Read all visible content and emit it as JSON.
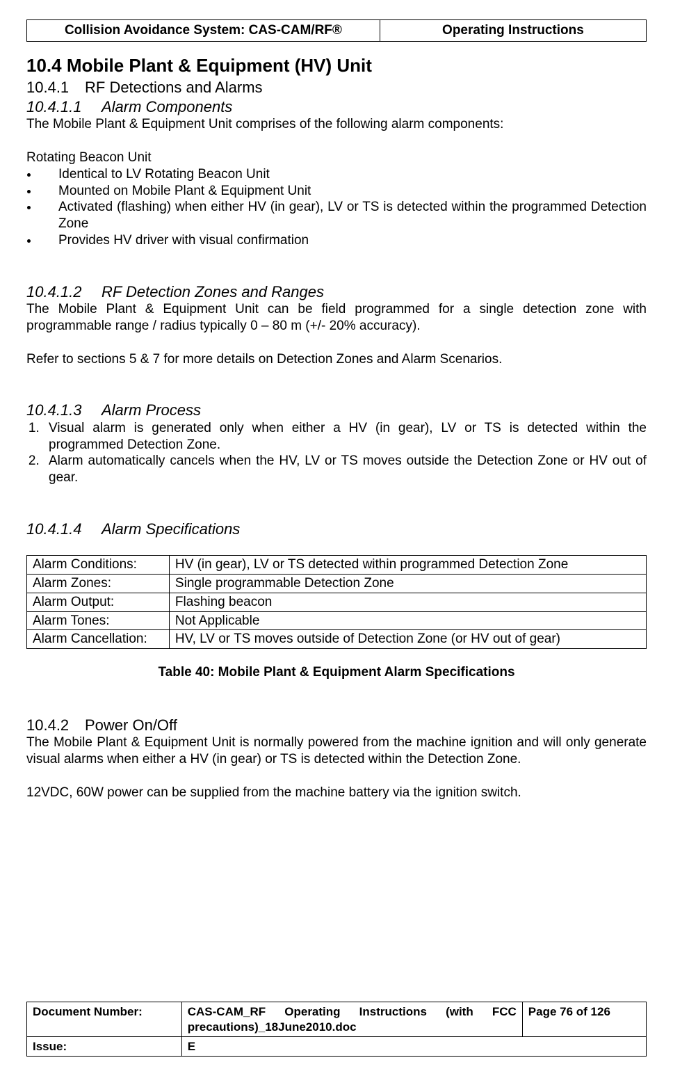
{
  "header": {
    "left": "Collision Avoidance System: CAS-CAM/RF®",
    "right": "Operating Instructions"
  },
  "sec10_4": {
    "num": "10.4",
    "title": "Mobile Plant & Equipment (HV) Unit"
  },
  "sec10_4_1": {
    "num": "10.4.1",
    "title": "RF Detections and Alarms"
  },
  "sec10_4_1_1": {
    "num": "10.4.1.1",
    "title": "Alarm Components",
    "intro": "The Mobile Plant & Equipment Unit comprises of the following alarm components:",
    "beacon_heading": "Rotating Beacon Unit",
    "bullets": [
      "Identical to LV Rotating Beacon Unit",
      "Mounted on Mobile Plant & Equipment Unit",
      "Activated (flashing) when either HV (in gear), LV or TS is detected within the programmed Detection Zone",
      "Provides HV driver with visual confirmation"
    ]
  },
  "sec10_4_1_2": {
    "num": "10.4.1.2",
    "title": "RF Detection Zones and Ranges",
    "p1": "The Mobile Plant & Equipment Unit can be field programmed for a single detection zone with programmable range / radius typically 0 – 80 m (+/- 20% accuracy).",
    "p2": "Refer to sections 5 & 7 for more details on Detection Zones and Alarm Scenarios."
  },
  "sec10_4_1_3": {
    "num": "10.4.1.3",
    "title": "Alarm Process",
    "items": [
      "Visual alarm is generated only when either a HV (in gear), LV or TS is detected within the programmed Detection Zone.",
      "Alarm automatically cancels when the HV, LV or TS moves outside the Detection Zone or HV out of gear."
    ]
  },
  "sec10_4_1_4": {
    "num": "10.4.1.4",
    "title": "Alarm Specifications",
    "rows": [
      {
        "k": "Alarm Conditions:",
        "v": "HV (in gear), LV or TS detected within programmed Detection Zone"
      },
      {
        "k": "Alarm Zones:",
        "v": "Single programmable Detection Zone"
      },
      {
        "k": "Alarm Output:",
        "v": "Flashing beacon"
      },
      {
        "k": "Alarm Tones:",
        "v": "Not Applicable"
      },
      {
        "k": "Alarm Cancellation:",
        "v": "HV, LV or TS moves outside of Detection Zone (or HV out of gear)"
      }
    ],
    "caption": "Table 40:  Mobile Plant & Equipment Alarm Specifications"
  },
  "sec10_4_2": {
    "num": "10.4.2",
    "title": "Power On/Off",
    "p1": "The Mobile Plant & Equipment Unit is normally powered from the machine ignition and will only generate visual alarms when either a HV (in gear) or TS is detected within the Detection Zone.",
    "p2": "12VDC, 60W power can be supplied from the machine battery via the ignition switch."
  },
  "footer": {
    "docnum_label": "Document Number:",
    "docnum_value": "CAS-CAM_RF Operating Instructions (with FCC precautions)_18June2010.doc",
    "page": "Page 76 of  126",
    "issue_label": "Issue:",
    "issue_value": "E"
  }
}
